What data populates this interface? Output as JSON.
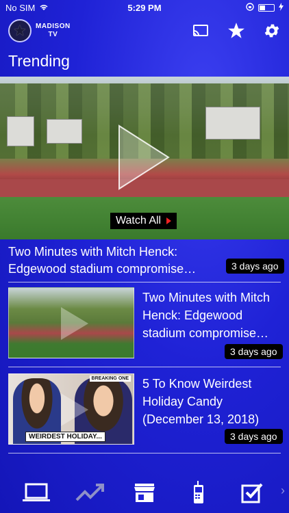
{
  "status_bar": {
    "carrier": "No SIM",
    "time": "5:29 PM"
  },
  "header": {
    "logo_text_line1": "MADISON",
    "logo_text_line2": "TV",
    "actions": [
      "cast-icon",
      "star-icon",
      "gear-icon"
    ]
  },
  "section": {
    "title": "Trending"
  },
  "hero": {
    "watch_all_label": "Watch All",
    "caption": "Two Minutes with Mitch Henck: Edgewood stadium compromise…",
    "age": "3 days ago"
  },
  "videos": [
    {
      "title": "Two Minutes with Mitch Henck: Edgewood stadium compromise…",
      "age": "3 days ago",
      "thumb": "stadium"
    },
    {
      "title": "5 To Know Weirdest Holiday Candy (December 13, 2018)",
      "age": "3 days ago",
      "thumb": "candy",
      "thumb_banner": "WEIRDEST HOLIDAY...",
      "thumb_tag": "BREAKING ONE"
    }
  ],
  "bottom_nav": [
    "laptop-icon",
    "trending-icon",
    "store-icon",
    "phone-icon",
    "checkbox-icon"
  ],
  "colors": {
    "background": "#1f22d6",
    "badge": "#000000",
    "accent_red": "#e22222"
  }
}
